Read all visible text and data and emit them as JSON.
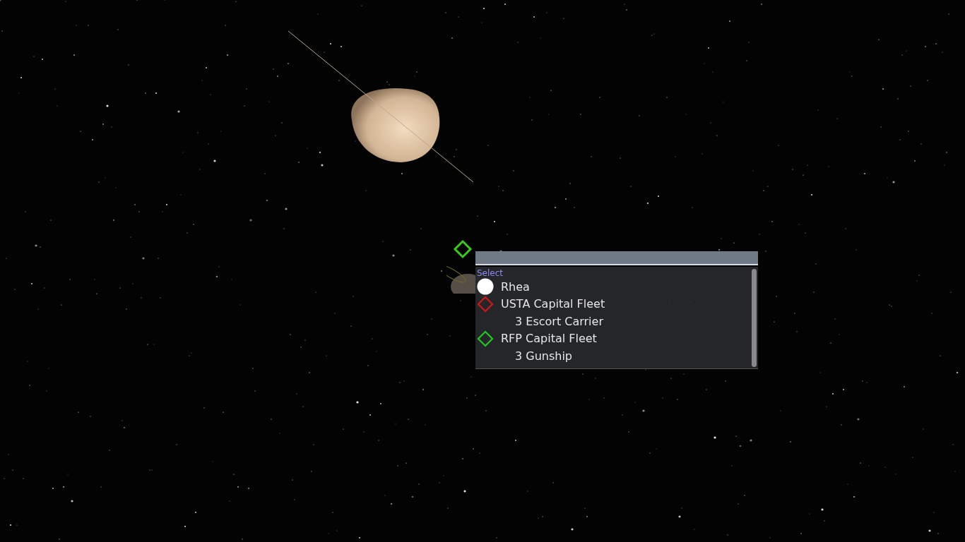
{
  "selection_popup": {
    "header": "Select",
    "items": [
      {
        "kind": "planet",
        "label": "Rhea"
      },
      {
        "kind": "fleet",
        "label": "USTA Capital Fleet",
        "color": "#d01818",
        "children": [
          {
            "label": "3 Escort Carrier"
          }
        ]
      },
      {
        "kind": "fleet",
        "label": "RFP Capital Fleet",
        "color": "#22c822",
        "children": [
          {
            "label": "3 Gunship"
          }
        ]
      }
    ]
  }
}
